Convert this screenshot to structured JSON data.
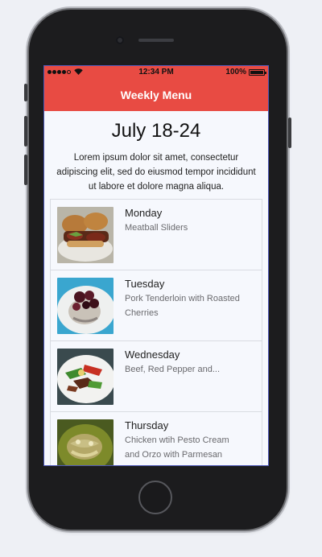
{
  "status_bar": {
    "time": "12:34 PM",
    "battery": "100%",
    "wifi_icon": "wifi-icon",
    "signal_icon": "signal-dots-icon",
    "battery_icon": "battery-icon"
  },
  "navbar": {
    "title": "Weekly Menu",
    "background": "#e84b43"
  },
  "header": {
    "date_range": "July 18-24",
    "intro": "Lorem ipsum dolor sit amet, consectetur adipiscing elit, sed do eiusmod tempor incididunt ut labore et dolore magna aliqua."
  },
  "menu": {
    "items": [
      {
        "day": "Monday",
        "dish": "Meatball Sliders",
        "thumb": "meatball-sliders-photo"
      },
      {
        "day": "Tuesday",
        "dish": "Pork Tenderloin with Roasted Cherries",
        "thumb": "pork-tenderloin-photo"
      },
      {
        "day": "Wednesday",
        "dish": "Beef, Red Pepper and...",
        "thumb": "beef-red-pepper-photo"
      },
      {
        "day": "Thursday",
        "dish": "Chicken wtih Pesto Cream and Orzo with Parmesan",
        "thumb": "chicken-pesto-photo"
      }
    ]
  }
}
